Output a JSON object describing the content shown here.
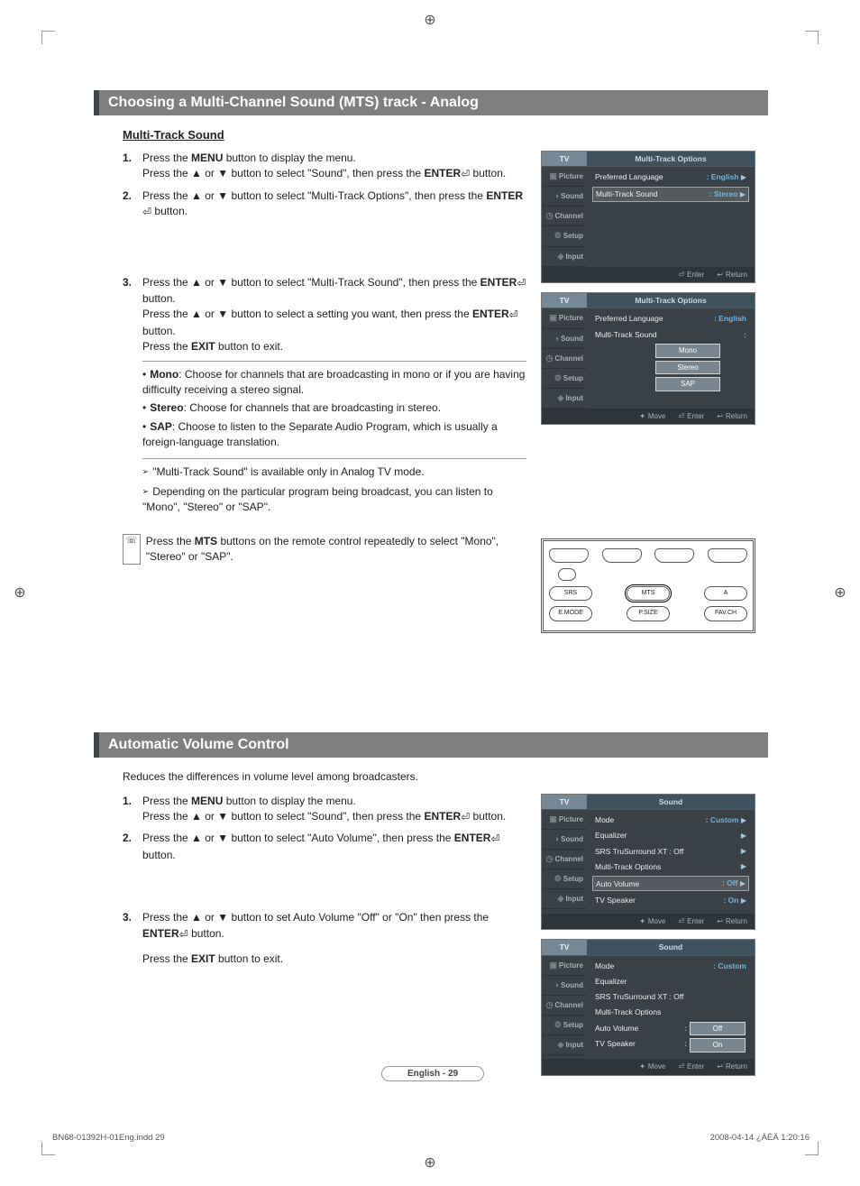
{
  "section1": {
    "title": "Choosing a Multi-Channel Sound (MTS) track - Analog",
    "subtitle": "Multi-Track Sound",
    "steps": {
      "n1": "1.",
      "s1a_pre": "Press the ",
      "s1a_b": "MENU",
      "s1a_post": " button to display the menu.",
      "s1b_pre": "Press the ▲ or ▼ button to select \"Sound\", then press the ",
      "s1b_b": "ENTER",
      "s1b_post": " button.",
      "n2": "2.",
      "s2a_pre": "Press the ▲ or ▼ button to select \"Multi-Track Options\", then press the ",
      "s2a_b": "ENTER",
      "s2a_post": " button.",
      "n3": "3.",
      "s3a_pre": "Press the ▲ or ▼ button to select \"Multi-Track Sound\", then press the ",
      "s3a_b": "ENTER",
      "s3a_post": " button.",
      "s3b_pre": "Press the ▲ or ▼ button to select a setting you want, then press the ",
      "s3b_b": "ENTER",
      "s3b_post": " button.",
      "s3c_pre": "Press the ",
      "s3c_b": "EXIT",
      "s3c_post": " button to exit."
    },
    "bullets": {
      "b1_lbl": "Mono",
      "b1_txt": ": Choose for channels that are broadcasting in mono or if you are having difficulty receiving a stereo signal.",
      "b2_lbl": "Stereo",
      "b2_txt": ": Choose for channels that are broadcasting in stereo.",
      "b3_lbl": "SAP",
      "b3_txt": ": Choose to listen to the Separate Audio Program, which is usually a foreign-language translation."
    },
    "arrows": {
      "a1": "\"Multi-Track Sound\" is available only in Analog TV mode.",
      "a2": "Depending on the particular program being broadcast, you can listen to \"Mono\", \"Stereo\" or \"SAP\"."
    },
    "remoteNote_pre": "Press the ",
    "remoteNote_b": "MTS",
    "remoteNote_post": " buttons on the remote control repeatedly to select \"Mono\", \"Stereo\" or \"SAP\"."
  },
  "section2": {
    "title": "Automatic Volume Control",
    "intro": "Reduces the differences in volume level among broadcasters.",
    "steps": {
      "n1": "1.",
      "s1a_pre": "Press the ",
      "s1a_b": "MENU",
      "s1a_post": " button to display the menu.",
      "s1b_pre": "Press the ▲ or ▼ button to select \"Sound\", then press the ",
      "s1b_b": "ENTER",
      "s1b_post": " button.",
      "n2": "2.",
      "s2a_pre": "Press the ▲ or ▼ button to select \"Auto Volume\", then press the ",
      "s2a_b": "ENTER",
      "s2a_post": " button.",
      "n3": "3.",
      "s3a_pre": "Press the ▲ or ▼ button to set Auto Volume \"Off\" or \"On\" then press the ",
      "s3a_b": "ENTER",
      "s3a_post": " button.",
      "s3b_pre": "Press the ",
      "s3b_b": "EXIT",
      "s3b_post": " button to exit."
    }
  },
  "osd1a": {
    "tv": "TV",
    "title": "Multi-Track Options",
    "tabs": [
      "Picture",
      "Sound",
      "Channel",
      "Setup",
      "Input"
    ],
    "r1l": "Preferred Language",
    "r1v": ": English",
    "r2l": "Multi-Track Sound",
    "r2v": ": Stereo",
    "bot": {
      "enter": "Enter",
      "return": "Return"
    }
  },
  "osd1b": {
    "tv": "TV",
    "title": "Multi-Track Options",
    "tabs": [
      "Picture",
      "Sound",
      "Channel",
      "Setup",
      "Input"
    ],
    "r1l": "Preferred Language",
    "r1v": ": English",
    "r2l": "Multi-Track Sound",
    "opts": [
      "Mono",
      "Stereo",
      "SAP"
    ],
    "bot": {
      "move": "Move",
      "enter": "Enter",
      "return": "Return"
    }
  },
  "osd2a": {
    "tv": "TV",
    "title": "Sound",
    "tabs": [
      "Picture",
      "Sound",
      "Channel",
      "Setup",
      "Input"
    ],
    "rows": [
      {
        "l": "Mode",
        "v": ": Custom"
      },
      {
        "l": "Equalizer",
        "v": ""
      },
      {
        "l": "SRS TruSurround XT : Off",
        "v": ""
      },
      {
        "l": "Multi-Track Options",
        "v": ""
      },
      {
        "l": "Auto Volume",
        "v": ": Off",
        "sel": true
      },
      {
        "l": "TV Speaker",
        "v": ": On"
      }
    ],
    "bot": {
      "move": "Move",
      "enter": "Enter",
      "return": "Return"
    }
  },
  "osd2b": {
    "tv": "TV",
    "title": "Sound",
    "tabs": [
      "Picture",
      "Sound",
      "Channel",
      "Setup",
      "Input"
    ],
    "rows": [
      {
        "l": "Mode",
        "v": ": Custom"
      },
      {
        "l": "Equalizer",
        "v": ""
      },
      {
        "l": "SRS TruSurround XT : Off",
        "v": ""
      },
      {
        "l": "Multi-Track Options",
        "v": ""
      },
      {
        "l": "Auto Volume",
        "v": ":"
      },
      {
        "l": "TV Speaker",
        "v": ":"
      }
    ],
    "opts": [
      "Off",
      "On"
    ],
    "bot": {
      "move": "Move",
      "enter": "Enter",
      "return": "Return"
    }
  },
  "remoteButtons": {
    "top": [
      "",
      "",
      "",
      ""
    ],
    "mid": [
      "SRS",
      "MTS",
      "A"
    ],
    "bot": [
      "E.MODE",
      "P.SIZE",
      "FAV.CH"
    ]
  },
  "pageNum": "English - 29",
  "footL": "BN68-01392H-01Eng.indd   29",
  "footR": "2008-04-14   ¿ÀÈÄ 1:20:16",
  "iconAlt": {
    "remoteIcon": "✆"
  },
  "sym": {
    "arrow": "➢",
    "enter": "⏎",
    "move": "✦",
    "ret": "↩"
  }
}
